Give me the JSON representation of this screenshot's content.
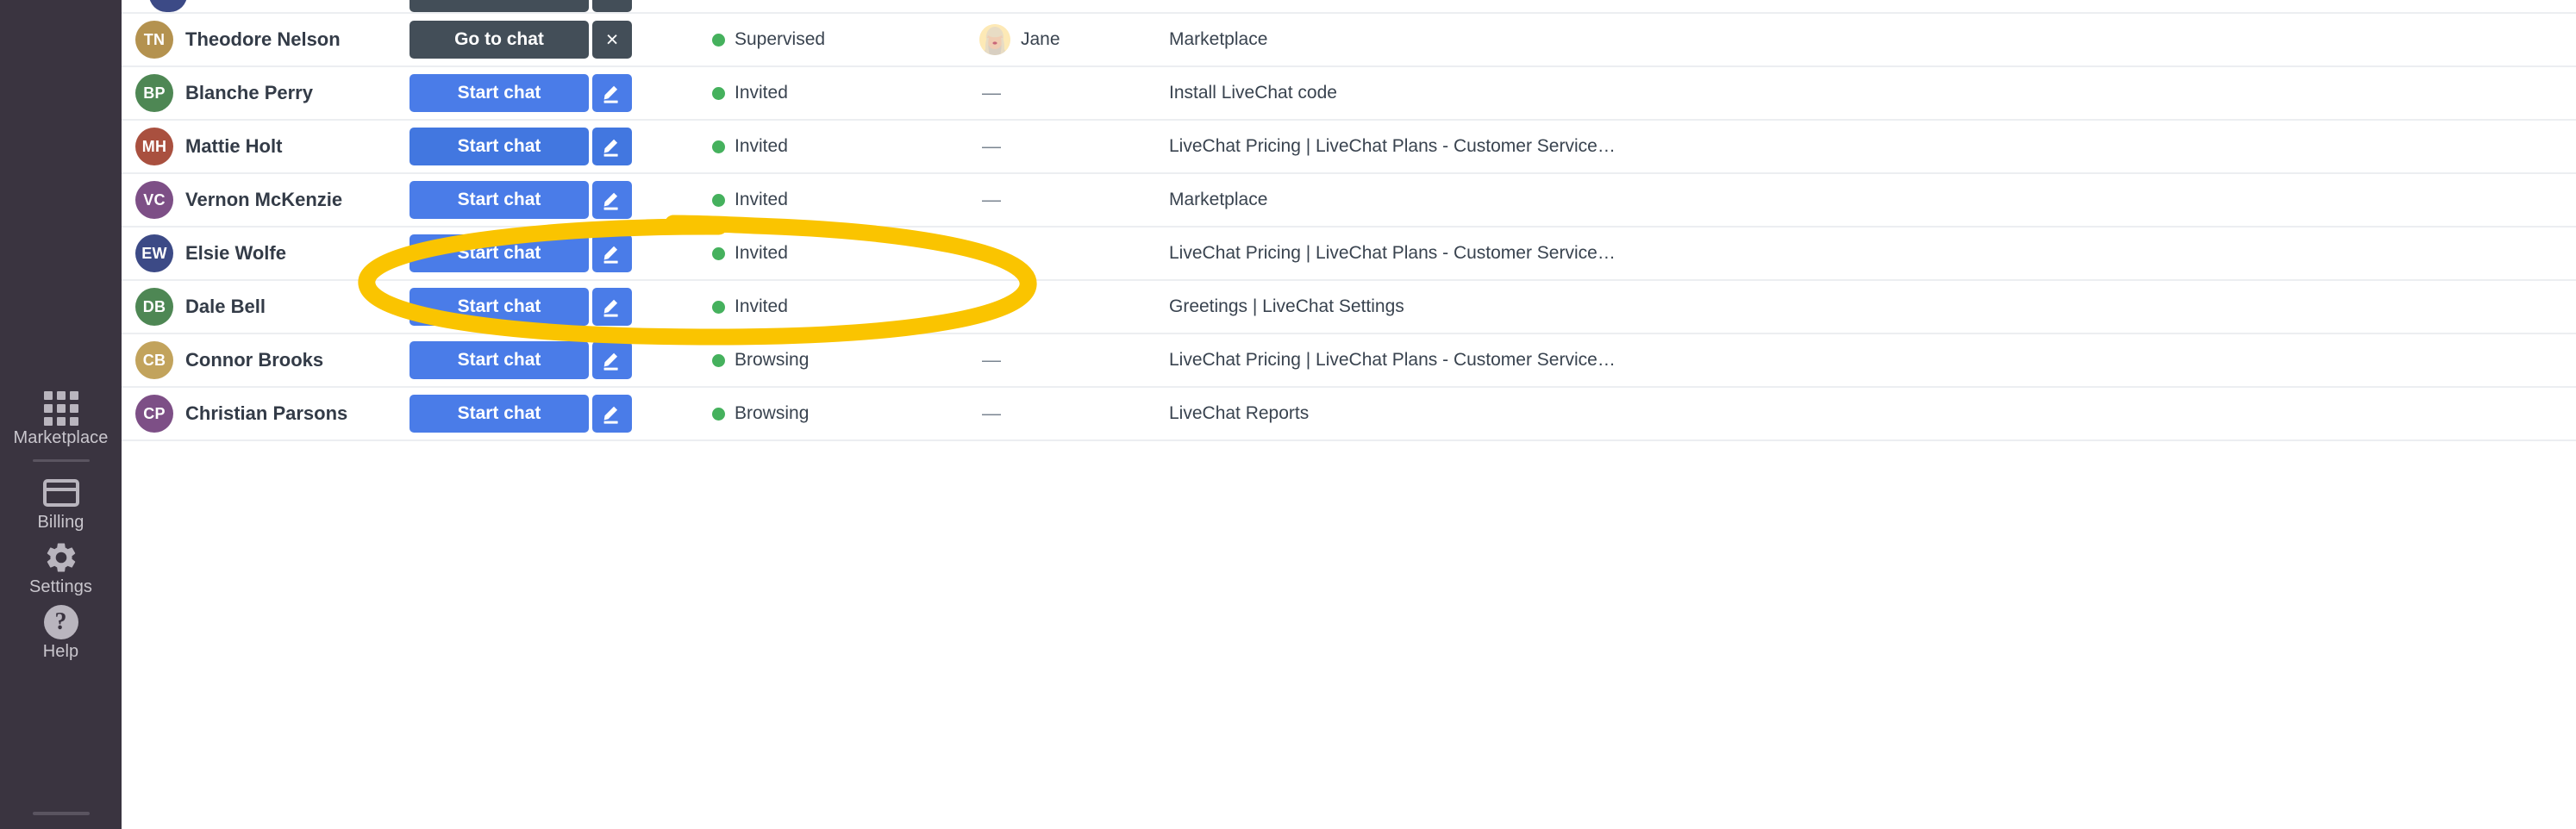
{
  "sidebar": {
    "items": [
      {
        "label": "Marketplace",
        "icon": "grid-icon"
      },
      {
        "label": "Billing",
        "icon": "credit-card-icon"
      },
      {
        "label": "Settings",
        "icon": "gear-icon"
      },
      {
        "label": "Help",
        "icon": "question-circle-icon"
      }
    ]
  },
  "colors": {
    "sidebar_bg": "#3a3440",
    "primary_blue": "#4a7ce8",
    "dark_button": "#434e58",
    "status_green": "#45b15d",
    "highlight_yellow": "#fac400",
    "row_divider": "#eceef1"
  },
  "annotation": {
    "type": "hand-drawn-ellipse",
    "color": "#fac400",
    "target": "start-chat-button-row-mattie-holt"
  },
  "buttons": {
    "go_to_chat": "Go to chat",
    "start_chat": "Start chat",
    "close_icon": "×",
    "edit_icon": "pencil-icon"
  },
  "visitors": [
    {
      "initials": "TN",
      "name": "Theodore Nelson",
      "avatar_color": "#b4924f",
      "action_label": "Go to chat",
      "action_style": "dark",
      "secondary_icon": "close-icon",
      "status": "Supervised",
      "agent": "Jane",
      "agent_has_photo": true,
      "page": "Marketplace",
      "highlighted": false
    },
    {
      "initials": "BP",
      "name": "Blanche Perry",
      "avatar_color": "#4e8754",
      "action_label": "Start chat",
      "action_style": "blue",
      "secondary_icon": "pencil-icon",
      "status": "Invited",
      "agent": "—",
      "agent_has_photo": false,
      "page": "Install LiveChat code",
      "highlighted": false
    },
    {
      "initials": "MH",
      "name": "Mattie Holt",
      "avatar_color": "#a9503f",
      "action_label": "Start chat",
      "action_style": "blue",
      "secondary_icon": "pencil-icon",
      "status": "Invited",
      "agent": "—",
      "agent_has_photo": false,
      "page": "LiveChat Pricing | LiveChat Plans - Customer Service…",
      "highlighted": true
    },
    {
      "initials": "VC",
      "name": "Vernon McKenzie",
      "avatar_color": "#7d4f86",
      "action_label": "Start chat",
      "action_style": "blue",
      "secondary_icon": "pencil-icon",
      "status": "Invited",
      "agent": "—",
      "agent_has_photo": false,
      "page": "Marketplace",
      "highlighted": false
    },
    {
      "initials": "EW",
      "name": "Elsie Wolfe",
      "avatar_color": "#3c4a86",
      "action_label": "Start chat",
      "action_style": "blue",
      "secondary_icon": "pencil-icon",
      "status": "Invited",
      "agent": "—",
      "agent_has_photo": false,
      "page": "LiveChat Pricing | LiveChat Plans - Customer Service…",
      "highlighted": false
    },
    {
      "initials": "DB",
      "name": "Dale Bell",
      "avatar_color": "#4e8754",
      "action_label": "Start chat",
      "action_style": "blue",
      "secondary_icon": "pencil-icon",
      "status": "Invited",
      "agent": "—",
      "agent_has_photo": false,
      "page": "Greetings | LiveChat Settings",
      "highlighted": false
    },
    {
      "initials": "CB",
      "name": "Connor Brooks",
      "avatar_color": "#c2a35c",
      "action_label": "Start chat",
      "action_style": "blue",
      "secondary_icon": "pencil-icon",
      "status": "Browsing",
      "agent": "—",
      "agent_has_photo": false,
      "page": "LiveChat Pricing | LiveChat Plans - Customer Service…",
      "highlighted": false
    },
    {
      "initials": "CP",
      "name": "Christian Parsons",
      "avatar_color": "#7d4f86",
      "action_label": "Start chat",
      "action_style": "blue",
      "secondary_icon": "pencil-icon",
      "status": "Browsing",
      "agent": "—",
      "agent_has_photo": false,
      "page": "LiveChat Reports",
      "highlighted": false
    }
  ]
}
